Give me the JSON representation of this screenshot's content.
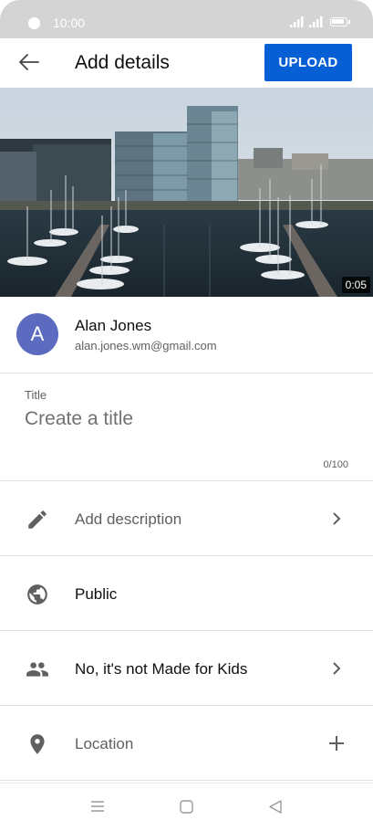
{
  "status_bar": {
    "time": "10:00"
  },
  "header": {
    "title": "Add details",
    "upload_label": "UPLOAD"
  },
  "video": {
    "duration": "0:05"
  },
  "account": {
    "avatar_letter": "A",
    "name": "Alan Jones",
    "email": "alan.jones.wm@gmail.com"
  },
  "title_field": {
    "label": "Title",
    "placeholder": "Create a title",
    "counter": "0/100"
  },
  "rows": [
    {
      "label": "Add description",
      "icon": "pencil-icon",
      "trailing": "chevron-right-icon"
    },
    {
      "label": "Public",
      "icon": "globe-icon",
      "trailing": ""
    },
    {
      "label": "No, it's not Made for Kids",
      "icon": "people-icon",
      "trailing": "chevron-right-icon"
    },
    {
      "label": "Location",
      "icon": "location-pin-icon",
      "trailing": "plus-icon"
    }
  ],
  "nav_bar": {
    "buttons": [
      "menu-icon",
      "home-icon",
      "back-triangle-icon"
    ]
  },
  "colors": {
    "accent": "#065fd4",
    "avatar": "#5c6bc0",
    "status_bar": "#d4d4d4"
  }
}
